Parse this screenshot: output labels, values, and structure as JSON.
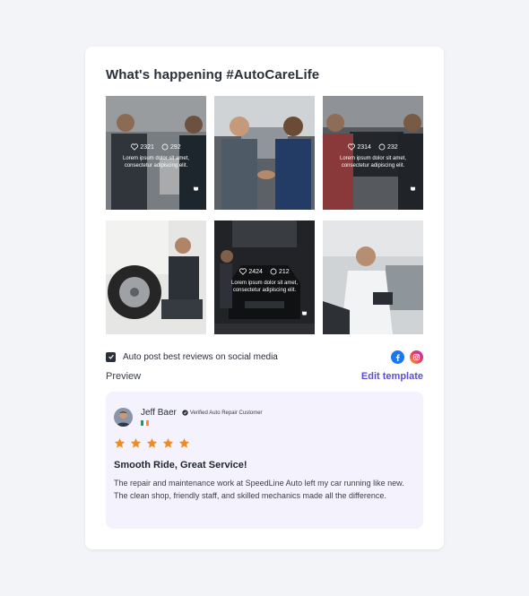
{
  "widget": {
    "title": "What's happening #AutoCareLife"
  },
  "gallery": {
    "tiles": [
      {
        "scene": "handshake-showroom",
        "likes": "2321",
        "comments": "292",
        "caption": "Lorem ipsum dolor sit amet, consectetur adipiscing elit.",
        "hover": true
      },
      {
        "scene": "mechanic-handshake",
        "hover": false
      },
      {
        "scene": "handshake-car",
        "likes": "2314",
        "comments": "232",
        "caption": "Lorem ipsum dolor sit amet, consectetur adipiscing elit.",
        "hover": true
      },
      {
        "scene": "tire-service",
        "hover": false
      },
      {
        "scene": "dark-garage-car",
        "likes": "2424",
        "comments": "212",
        "caption": "Lorem ipsum dolor sit amet, consectetur adipiscing elit.",
        "hover": true
      },
      {
        "scene": "man-with-tablet",
        "hover": false
      }
    ]
  },
  "autopost": {
    "checked": true,
    "label": "Auto post best reviews on social media",
    "socials": [
      "facebook-icon",
      "instagram-icon"
    ]
  },
  "preview": {
    "label": "Preview",
    "edit_label": "Edit template"
  },
  "review": {
    "name": "Jeff Baer",
    "badge": "Verified Auto Repair Customer",
    "flag_colors": [
      "#169b62",
      "#ffffff",
      "#ff883e"
    ],
    "rating": 5,
    "star_color": "#f28a1e",
    "title": "Smooth Ride, Great Service!",
    "body": "The repair and maintenance work at SpeedLine Auto left my car running like new. The clean shop, friendly staff, and skilled mechanics made all the difference."
  },
  "colors": {
    "accent": "#5a4fd6",
    "review_bg": "#f4f2fd",
    "page_bg": "#f3f4f8"
  }
}
